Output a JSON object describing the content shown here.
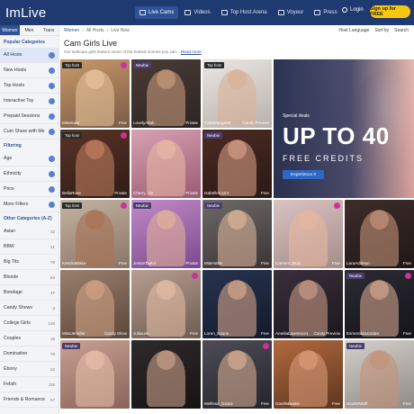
{
  "header": {
    "logo": "ImLive",
    "menu": [
      {
        "label": "Live Cams",
        "icon": "camera-icon",
        "active": true
      },
      {
        "label": "Videos",
        "icon": "video-icon",
        "active": false
      },
      {
        "label": "Top Host Arena",
        "icon": "trophy-icon",
        "active": false
      },
      {
        "label": "Voyeur",
        "icon": "eye-icon",
        "active": false
      },
      {
        "label": "Press",
        "icon": "press-icon",
        "active": false
      }
    ],
    "login": "Login",
    "signup": "Sign up for FREE"
  },
  "sidebar": {
    "tabs": [
      "Women",
      "Men",
      "Trans"
    ],
    "popular_title": "Popular Categories",
    "popular": [
      "All Hosts",
      "New Hosts",
      "Top Hosts",
      "Interactive Toy",
      "Prepaid Sessions",
      "Cum Share with Me"
    ],
    "filtering_title": "Filtering",
    "filters": [
      "Age",
      "Ethnicity",
      "Price",
      "More Filters"
    ],
    "other_title": "Other Categories (A-Z)",
    "other": [
      {
        "label": "Asian",
        "count": "22"
      },
      {
        "label": "BBW",
        "count": "21"
      },
      {
        "label": "Big Tits",
        "count": "79"
      },
      {
        "label": "Blonde",
        "count": "64"
      },
      {
        "label": "Bondage",
        "count": "47"
      },
      {
        "label": "Candy Shows",
        "count": "3"
      },
      {
        "label": "College Girls",
        "count": "126"
      },
      {
        "label": "Couples",
        "count": "16"
      },
      {
        "label": "Domination",
        "count": "78"
      },
      {
        "label": "Ebony",
        "count": "32"
      },
      {
        "label": "Fetish",
        "count": "115"
      },
      {
        "label": "Friends & Romance",
        "count": "57"
      }
    ]
  },
  "main": {
    "breadcrumb": [
      "Women",
      "All Hosts",
      "Live Now"
    ],
    "host_language": "Host Language",
    "sort": "Sort by",
    "search": "Search",
    "title": "Cam Girls Live",
    "description": "Our webcam girls feature some of the hottest scenes you can...",
    "read_more": "Read more",
    "promo": {
      "tag": "Special deals",
      "headline": "UP TO 40",
      "subline": "FREE CREDITS",
      "button": "Experience it"
    },
    "tiles": [
      {
        "name": "MissKate",
        "label": "Top host",
        "status": "Free",
        "colors": [
          "#c99a6b",
          "#7a5a46"
        ],
        "skin": "#e6c39a"
      },
      {
        "name": "LovelyAliah",
        "label": "Newbie",
        "status": "Private",
        "colors": [
          "#4b3b34",
          "#2a2524"
        ],
        "skin": "#c79a7c"
      },
      {
        "name": "CarlaMargaret",
        "label": "Top host",
        "status": "Candy Preview",
        "colors": [
          "#eae6e3",
          "#b9b1aa"
        ],
        "skin": "#d9b096"
      },
      {
        "name": "BellaRose",
        "label": "Top host",
        "status": "Private",
        "colors": [
          "#5a3326",
          "#2e1c17"
        ],
        "skin": "#c07d5f"
      },
      {
        "name": "Cherry_nix",
        "label": "",
        "status": "Private",
        "colors": [
          "#d8a2b3",
          "#9a5a72"
        ],
        "skin": "#e8b8a4"
      },
      {
        "name": "IsabelleCarro",
        "label": "Newbie",
        "status": "Free",
        "colors": [
          "#4b2a22",
          "#2b1916"
        ],
        "skin": "#d49c83"
      },
      {
        "name": "KendraBlake",
        "label": "Top host",
        "status": "Free",
        "colors": [
          "#c4b3a3",
          "#8a7565"
        ],
        "skin": "#a87254"
      },
      {
        "name": "JessieTaylor",
        "label": "Newbie",
        "status": "Private",
        "colors": [
          "#c289c9",
          "#7a4a8c"
        ],
        "skin": "#e0b09a"
      },
      {
        "name": "MiaHot69",
        "label": "Newbie",
        "status": "Free",
        "colors": [
          "#6e6a68",
          "#3a3534"
        ],
        "skin": "#d9b29a"
      },
      {
        "name": "Carmen_Ruiz",
        "label": "",
        "status": "Free",
        "colors": [
          "#d9c3c3",
          "#a48c88"
        ],
        "skin": "#e6b7a0"
      },
      {
        "name": "LaraAddison",
        "label": "",
        "status": "Free",
        "colors": [
          "#3d2d2a",
          "#1f1716"
        ],
        "skin": "#c5927a"
      },
      {
        "name": "MissJennifer",
        "label": "",
        "status": "Candy Show",
        "colors": [
          "#9a7f6e",
          "#5b4638"
        ],
        "skin": "#d0a184"
      },
      {
        "name": "JuliaLee",
        "label": "",
        "status": "Free",
        "colors": [
          "#b89d91",
          "#6e5b52"
        ],
        "skin": "#e3bca3"
      },
      {
        "name": "Loren_Evans",
        "label": "",
        "status": "Free",
        "colors": [
          "#27334f",
          "#131a2c"
        ],
        "skin": "#d4a58a"
      },
      {
        "name": "AmeliaLawrence1",
        "label": "",
        "status": "Candy Preview",
        "colors": [
          "#3a2f3b",
          "#1b171d"
        ],
        "skin": "#c69a86"
      },
      {
        "name": "EsmeraldaJordan",
        "label": "Newbie",
        "status": "Free",
        "colors": [
          "#2c2a33",
          "#151419"
        ],
        "skin": "#d2a58e"
      },
      {
        "name": "",
        "label": "Newbie",
        "status": "",
        "colors": [
          "#c9a093",
          "#8a6459"
        ],
        "skin": "#e6bea9"
      },
      {
        "name": "",
        "label": "",
        "status": "",
        "colors": [
          "#2f2a2b",
          "#161314"
        ],
        "skin": "#caa08a"
      },
      {
        "name": "Mellissa_Grace",
        "label": "",
        "status": "Free",
        "colors": [
          "#4e4d57",
          "#25242a"
        ],
        "skin": "#d5ab92"
      },
      {
        "name": "GiselleBanks",
        "label": "",
        "status": "Free",
        "colors": [
          "#b06a3d",
          "#5e3520"
        ],
        "skin": "#d89a78"
      },
      {
        "name": "ScarletWolf",
        "label": "Newbie",
        "status": "Free",
        "colors": [
          "#d4d0cc",
          "#8f8a86"
        ],
        "skin": "#c39178"
      }
    ]
  }
}
